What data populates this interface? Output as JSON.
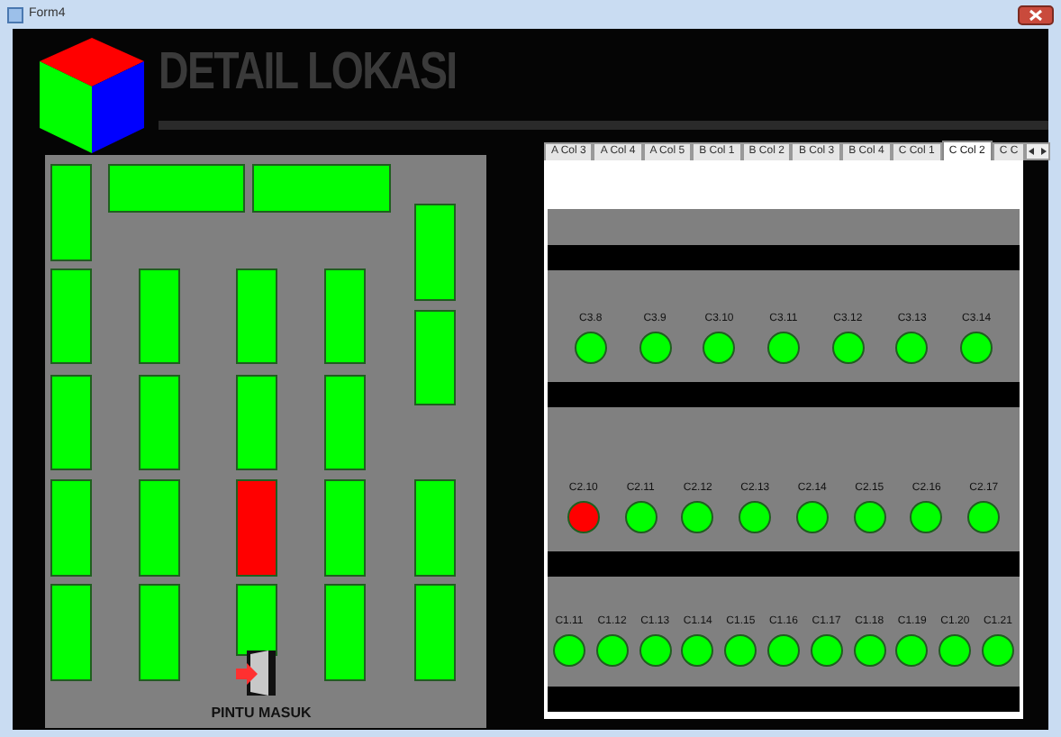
{
  "window": {
    "title": "Form4"
  },
  "header": {
    "title": "DETAIL LOKASI"
  },
  "floor_plan": {
    "racks": [
      {
        "color": "#00ff00"
      },
      {
        "color": "#00ff00"
      },
      {
        "color": "#00ff00"
      },
      {
        "color": "#00ff00"
      },
      {
        "color": "#00ff00"
      },
      {
        "color": "#00ff00"
      },
      {
        "color": "#00ff00"
      },
      {
        "color": "#00ff00"
      },
      {
        "color": "#00ff00"
      },
      {
        "color": "#00ff00"
      },
      {
        "color": "#00ff00"
      },
      {
        "color": "#00ff00"
      },
      {
        "color": "#00ff00"
      },
      {
        "color": "#ff0000"
      },
      {
        "color": "#00ff00"
      },
      {
        "color": "#00ff00"
      },
      {
        "color": "#00ff00"
      },
      {
        "color": "#00ff00"
      },
      {
        "color": "#00ff00"
      },
      {
        "color": "#00ff00"
      },
      {
        "color": "#00ff00"
      },
      {
        "color": "#00ff00"
      },
      {
        "color": "#00ff00"
      }
    ],
    "door_label": "PINTU MASUK"
  },
  "tabs": [
    {
      "label": "A Col 3",
      "selected": false
    },
    {
      "label": "A Col 4",
      "selected": false
    },
    {
      "label": "A Col 5",
      "selected": false
    },
    {
      "label": "B Col 1",
      "selected": false
    },
    {
      "label": "B Col 2",
      "selected": false
    },
    {
      "label": "B Col 3",
      "selected": false
    },
    {
      "label": "B Col 4",
      "selected": false
    },
    {
      "label": "C Col 1",
      "selected": false
    },
    {
      "label": "C Col 2",
      "selected": true
    },
    {
      "label": "C C",
      "selected": false
    }
  ],
  "sections": [
    {
      "slots": [
        {
          "label": "C3.8",
          "color": "#00ff00"
        },
        {
          "label": "C3.9",
          "color": "#00ff00"
        },
        {
          "label": "C3.10",
          "color": "#00ff00"
        },
        {
          "label": "C3.11",
          "color": "#00ff00"
        },
        {
          "label": "C3.12",
          "color": "#00ff00"
        },
        {
          "label": "C3.13",
          "color": "#00ff00"
        },
        {
          "label": "C3.14",
          "color": "#00ff00"
        }
      ]
    },
    {
      "slots": [
        {
          "label": "C2.10",
          "color": "#ff0000"
        },
        {
          "label": "C2.11",
          "color": "#00ff00"
        },
        {
          "label": "C2.12",
          "color": "#00ff00"
        },
        {
          "label": "C2.13",
          "color": "#00ff00"
        },
        {
          "label": "C2.14",
          "color": "#00ff00"
        },
        {
          "label": "C2.15",
          "color": "#00ff00"
        },
        {
          "label": "C2.16",
          "color": "#00ff00"
        },
        {
          "label": "C2.17",
          "color": "#00ff00"
        }
      ]
    },
    {
      "slots": [
        {
          "label": "C1.11",
          "color": "#00ff00"
        },
        {
          "label": "C1.12",
          "color": "#00ff00"
        },
        {
          "label": "C1.13",
          "color": "#00ff00"
        },
        {
          "label": "C1.14",
          "color": "#00ff00"
        },
        {
          "label": "C1.15",
          "color": "#00ff00"
        },
        {
          "label": "C1.16",
          "color": "#00ff00"
        },
        {
          "label": "C1.17",
          "color": "#00ff00"
        },
        {
          "label": "C1.18",
          "color": "#00ff00"
        },
        {
          "label": "C1.19",
          "color": "#00ff00"
        },
        {
          "label": "C1.20",
          "color": "#00ff00"
        },
        {
          "label": "C1.21",
          "color": "#00ff00"
        }
      ]
    }
  ]
}
